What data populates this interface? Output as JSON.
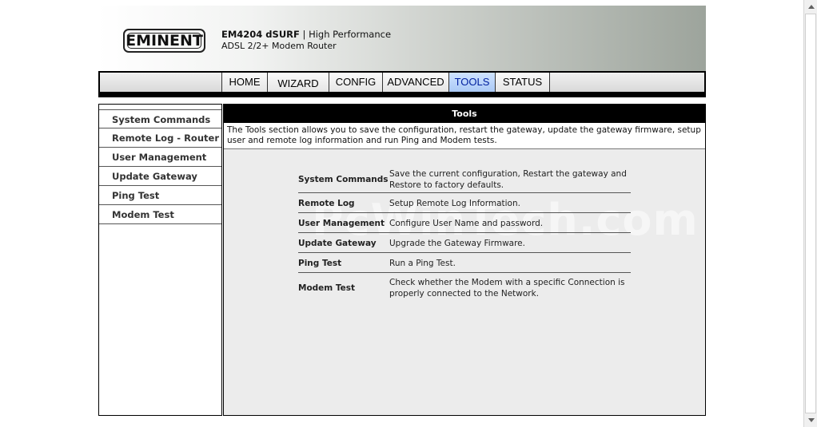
{
  "header": {
    "logo_text": "EMINENT",
    "model": "EM4204 dSURF",
    "separator": "|",
    "tagline": "High Performance",
    "subtitle": "ADSL 2/2+ Modem Router"
  },
  "nav": {
    "tabs": [
      {
        "label": "HOME"
      },
      {
        "label": "WIZARD"
      },
      {
        "label": "CONFIG"
      },
      {
        "label": "ADVANCED"
      },
      {
        "label": "TOOLS",
        "active": true
      },
      {
        "label": "STATUS"
      }
    ]
  },
  "sidebar": {
    "items": [
      {
        "label": "System Commands"
      },
      {
        "label": "Remote Log - Router"
      },
      {
        "label": "User Management"
      },
      {
        "label": "Update Gateway"
      },
      {
        "label": "Ping Test"
      },
      {
        "label": "Modem Test"
      }
    ]
  },
  "content": {
    "title": "Tools",
    "description": "The Tools section allows you to save the configuration, restart the gateway, update the gateway firmware, setup user and remote log information and run Ping and Modem tests.",
    "watermark": "PcWinTech.com",
    "rows": [
      {
        "name": "System Commands",
        "desc": "Save the current configuration, Restart the gateway and Restore to factory defaults."
      },
      {
        "name": "Remote Log",
        "desc": "Setup Remote Log Information."
      },
      {
        "name": "User Management",
        "desc": "Configure User Name and password."
      },
      {
        "name": "Update Gateway",
        "desc": "Upgrade the Gateway Firmware."
      },
      {
        "name": "Ping Test",
        "desc": "Run a Ping Test."
      },
      {
        "name": "Modem Test",
        "desc": "Check whether the Modem with a specific Connection is properly connected to the Network."
      }
    ]
  },
  "colors": {
    "active_tab_text": "#00209f",
    "title_bar_bg": "#000000",
    "content_bg": "#ececec"
  }
}
